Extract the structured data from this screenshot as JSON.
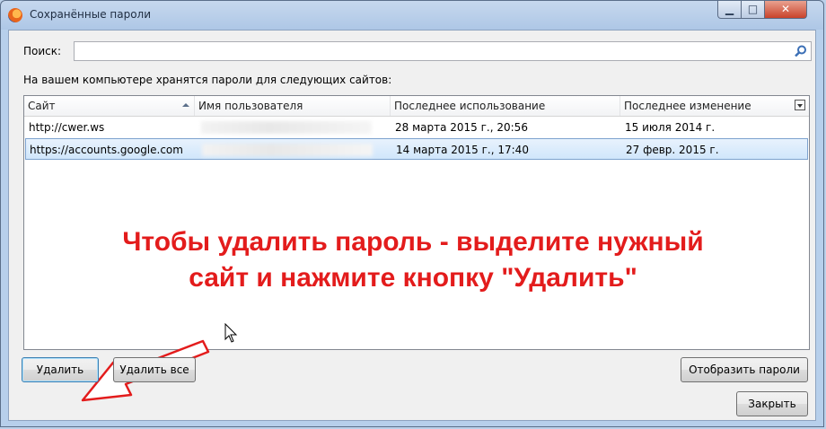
{
  "window": {
    "title": "Сохранённые пароли"
  },
  "search": {
    "label": "Поиск:",
    "value": "",
    "placeholder": ""
  },
  "description": "На вашем компьютере хранятся пароли для следующих сайтов:",
  "table": {
    "columns": [
      "Сайт",
      "Имя пользователя",
      "Последнее использование",
      "Последнее изменение"
    ],
    "rows": [
      {
        "site": "http://cwer.ws",
        "username": "",
        "last_used": "28 марта 2015 г., 20:56",
        "last_changed": "15 июля 2014 г.",
        "selected": false
      },
      {
        "site": "https://accounts.google.com",
        "username": "",
        "last_used": "14 марта 2015 г., 17:40",
        "last_changed": "27 февр. 2015 г.",
        "selected": true
      }
    ]
  },
  "instruction": {
    "line1": "Чтобы удалить пароль - выделите нужный",
    "line2": "сайт и нажмите кнопку \"Удалить\""
  },
  "buttons": {
    "delete": "Удалить",
    "delete_all": "Удалить все",
    "show_passwords": "Отобразить пароли",
    "close": "Закрыть"
  },
  "colors": {
    "annotation": "#e31c1c",
    "selection": "#d0e6fb"
  },
  "icons": [
    "firefox-icon",
    "minimize-icon",
    "maximize-icon",
    "close-icon",
    "search-icon",
    "sort-asc-icon",
    "column-picker-icon",
    "arrow-annotation-icon",
    "mouse-cursor-icon"
  ]
}
